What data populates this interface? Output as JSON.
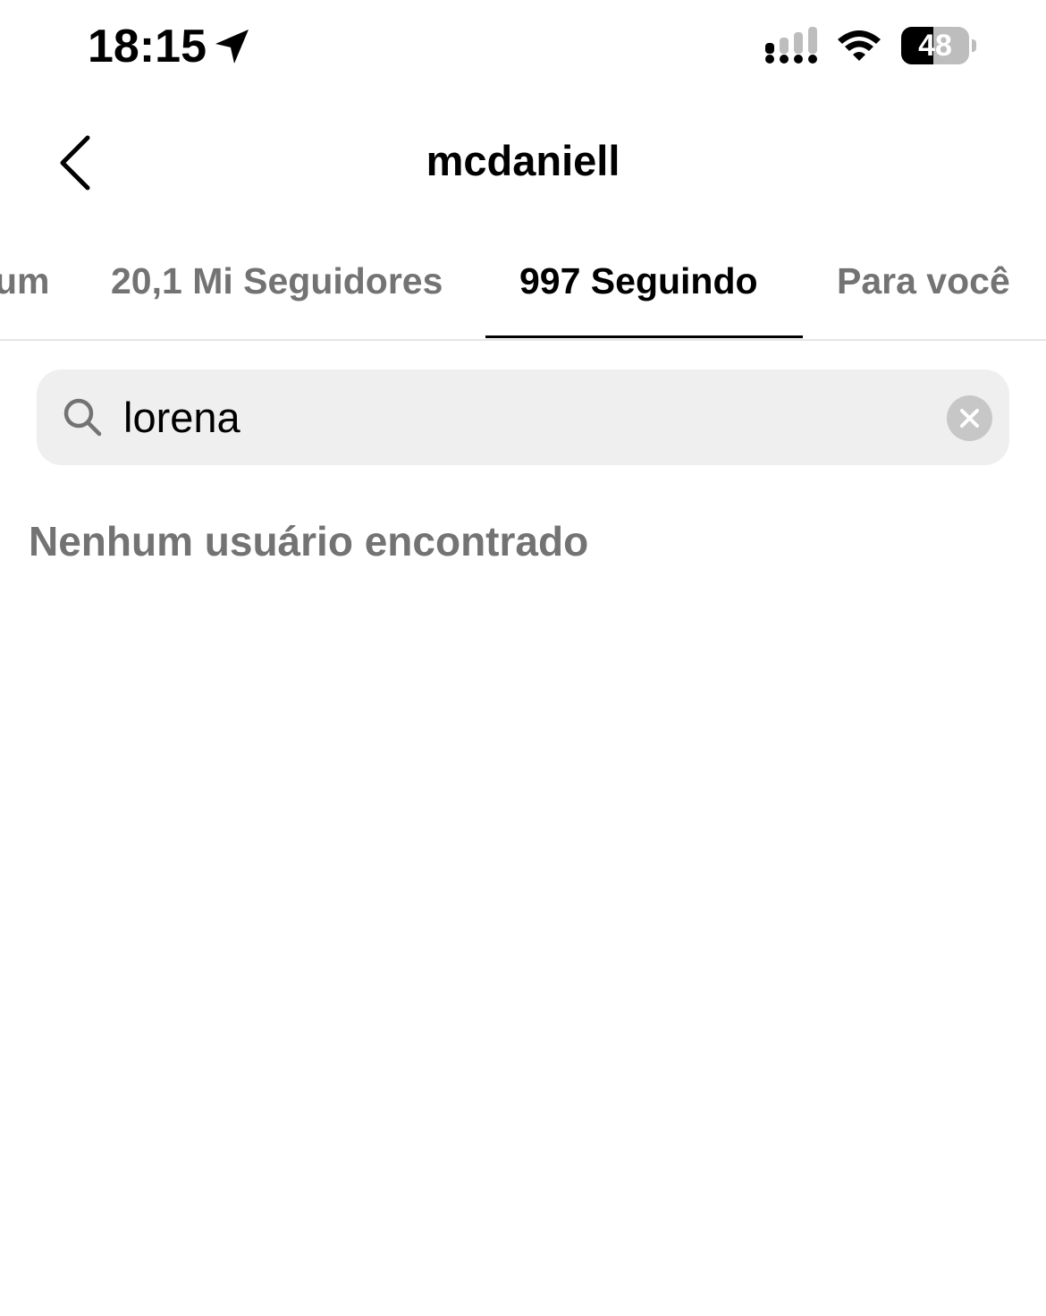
{
  "status_bar": {
    "time": "18:15",
    "battery_percent": "48",
    "battery_level": 0.48,
    "icons": [
      "location-arrow-icon",
      "cellular-signal-icon",
      "wifi-icon",
      "battery-icon"
    ]
  },
  "header": {
    "back_icon": "chevron-left-icon",
    "title": "mcdaniell"
  },
  "tabs": [
    {
      "label": "um",
      "active": false
    },
    {
      "label": "20,1 Mi Seguidores",
      "active": false
    },
    {
      "label": "997 Seguindo",
      "active": true
    },
    {
      "label": "Para você",
      "active": false
    }
  ],
  "search": {
    "icon": "search-icon",
    "value": "lorena",
    "clear_icon": "clear-x-icon"
  },
  "results": {
    "empty_message": "Nenhum usuário encontrado"
  },
  "colors": {
    "inactive_text": "#737373",
    "search_bg": "#efefef",
    "divider": "#e6e6e6"
  }
}
